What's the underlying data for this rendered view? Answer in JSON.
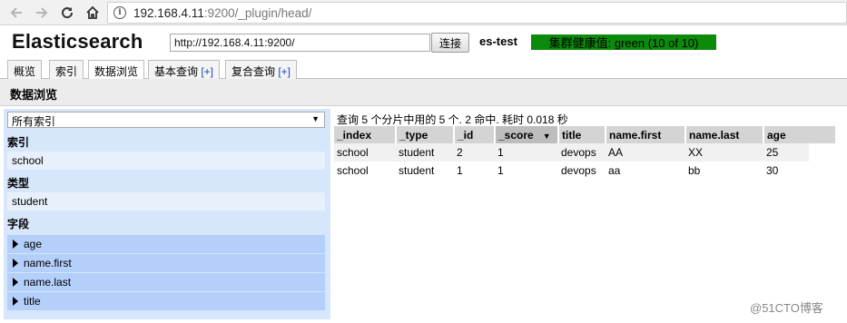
{
  "browser": {
    "url_host": "192.168.4.11",
    "url_rest": ":9200/_plugin/head/"
  },
  "app": {
    "title": "Elasticsearch",
    "connect_url": "http://192.168.4.11:9200/",
    "connect_label": "连接",
    "cluster_name": "es-test",
    "health_text": "集群健康值: green (10 of 10)",
    "health_color": "#0b8a0b"
  },
  "tabs": [
    {
      "label": "概览",
      "plus": ""
    },
    {
      "label": "索引",
      "plus": ""
    },
    {
      "label": "数据浏览",
      "plus": ""
    },
    {
      "label": "基本查询 ",
      "plus": "[+]"
    },
    {
      "label": "复合查询 ",
      "plus": "[+]"
    }
  ],
  "section_title": "数据浏览",
  "sidebar": {
    "index_select": "所有索引",
    "index_label": "索引",
    "index_value": "school",
    "type_label": "类型",
    "type_value": "student",
    "fields_label": "字段",
    "fields": [
      "age",
      "name.first",
      "name.last",
      "title"
    ]
  },
  "results": {
    "info": "查询 5 个分片中用的 5 个. 2 命中. 耗时 0.018 秒",
    "columns": [
      "_index",
      "_type",
      "_id",
      "_score",
      "title",
      "name.first",
      "name.last",
      "age"
    ],
    "rows": [
      [
        "school",
        "student",
        "2",
        "1",
        "devops",
        "AA",
        "XX",
        "25"
      ],
      [
        "school",
        "student",
        "1",
        "1",
        "devops",
        "aa",
        "bb",
        "30"
      ]
    ]
  },
  "watermark": "@51CTO博客"
}
